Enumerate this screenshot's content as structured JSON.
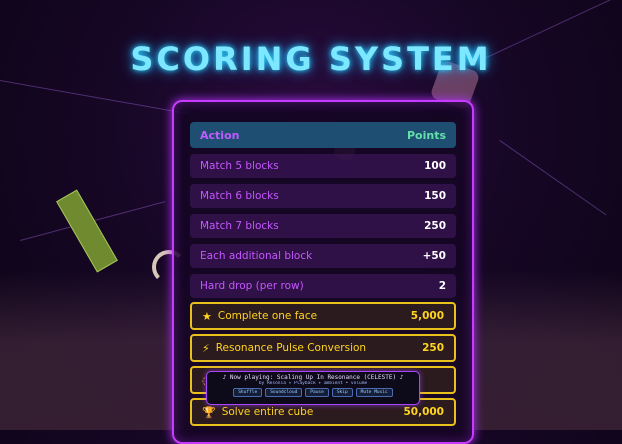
{
  "title": "SCORING SYSTEM",
  "table": {
    "header": {
      "action": "Action",
      "points": "Points"
    },
    "rows": [
      {
        "label": "Match 5 blocks",
        "value": "100"
      },
      {
        "label": "Match 6 blocks",
        "value": "150"
      },
      {
        "label": "Match 7 blocks",
        "value": "250"
      },
      {
        "label": "Each additional block",
        "value": "+50"
      },
      {
        "label": "Hard drop (per row)",
        "value": "2"
      }
    ],
    "special_rows": [
      {
        "icon": "star-icon",
        "glyph": "★",
        "label": "Complete one face",
        "value": "5,000"
      },
      {
        "icon": "lightning-icon",
        "glyph": "⚡",
        "label": "Resonance Pulse Conversion",
        "value": "250"
      },
      {
        "icon": "partially-hidden-icon",
        "glyph": "◌",
        "label": "",
        "value": ""
      },
      {
        "icon": "trophy-icon",
        "glyph": "🏆",
        "label": "Solve entire cube",
        "value": "50,000"
      }
    ]
  },
  "now_playing": {
    "line1": "♪ Now playing: Scaling Up In Resonance (CELESTE) ♪",
    "line2": "by Resonia ✦ Playback ✦ ambient • volume",
    "buttons": [
      "Shuffle",
      "Soundcloud",
      "Pause",
      "Skip",
      "Mute Music"
    ]
  },
  "colors": {
    "title": "#7de7ff",
    "panel_border": "#c63bff",
    "gold": "#e8c21b",
    "header_bg": "#1f4e73"
  }
}
